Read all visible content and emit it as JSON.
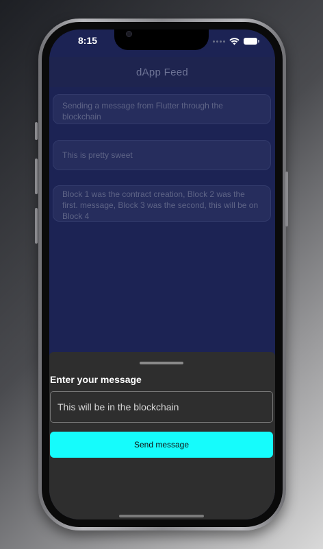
{
  "status_bar": {
    "time": "8:15",
    "icons": [
      "signal-dots-icon",
      "wifi-icon",
      "battery-icon"
    ]
  },
  "app_bar": {
    "title": "dApp Feed"
  },
  "feed": {
    "messages": [
      {
        "text": "Sending a message from Flutter through the blockchain"
      },
      {
        "text": "This is pretty sweet"
      },
      {
        "text": "Block 1 was the contract creation, Block 2 was the first. message, Block 3 was the second, this will be on Block 4"
      }
    ]
  },
  "sheet": {
    "label": "Enter your message",
    "input_value": "This will be in the blockchain",
    "send_label": "Send message"
  },
  "colors": {
    "feed_background": "#1c2354",
    "sheet_background": "#2e2e2e",
    "accent": "#15fcfc"
  }
}
